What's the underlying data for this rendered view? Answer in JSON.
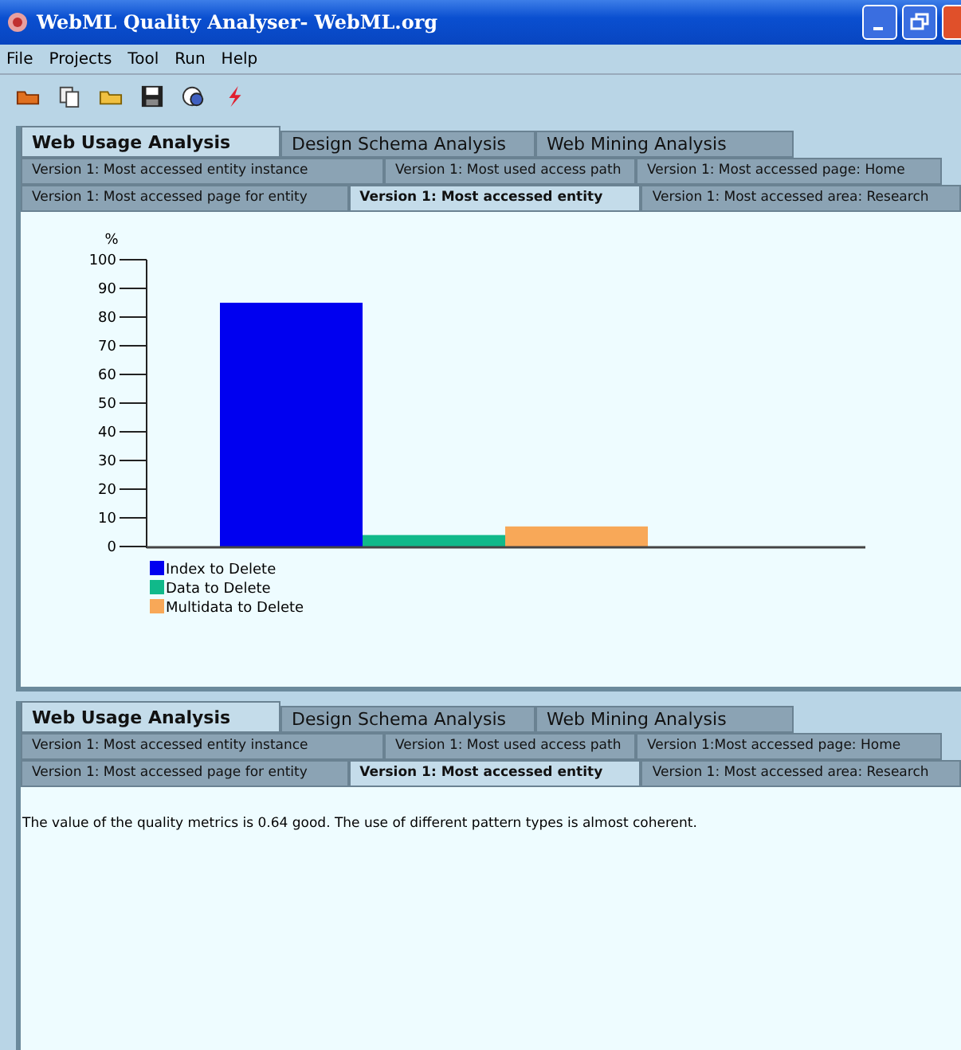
{
  "window": {
    "title": "WebML Quality Analyser- WebML.org"
  },
  "menu": [
    "File",
    "Projects",
    "Tool",
    "Run",
    "Help"
  ],
  "panels": [
    {
      "kind": "chart",
      "tabs": [
        {
          "label": "Web Usage Analysis",
          "selected": true
        },
        {
          "label": "Design Schema Analysis",
          "selected": false
        },
        {
          "label": "Web Mining Analysis",
          "selected": false
        }
      ],
      "sub_tab_rows": [
        [
          {
            "label": "Version 1: Most accessed entity instance",
            "selected": false
          },
          {
            "label": "Version 1: Most used access path",
            "selected": false
          },
          {
            "label": "Version 1: Most accessed page: Home",
            "selected": false
          }
        ],
        [
          {
            "label": "Version 1: Most accessed page for entity",
            "selected": false
          },
          {
            "label": "Version 1: Most accessed entity",
            "selected": true
          },
          {
            "label": "Version 1: Most accessed area: Research",
            "selected": false
          }
        ]
      ],
      "chart_data": {
        "type": "bar",
        "ylabel": "%",
        "legend": "bottom-left",
        "series": [
          {
            "name": "Index to Delete",
            "color": "#0000f0",
            "values": [
              85
            ]
          },
          {
            "name": "Data to Delete",
            "color": "#10b98a",
            "values": [
              4
            ]
          },
          {
            "name": "Multidata to Delete",
            "color": "#f8a858",
            "values": [
              7
            ]
          }
        ],
        "ylim": [
          0,
          100
        ],
        "yticks": [
          0,
          10,
          20,
          30,
          40,
          50,
          60,
          70,
          80,
          90,
          100
        ]
      }
    },
    {
      "kind": "text",
      "tabs": [
        {
          "label": "Web Usage Analysis",
          "selected": true
        },
        {
          "label": "Design Schema Analysis",
          "selected": false
        },
        {
          "label": "Web Mining Analysis",
          "selected": false
        }
      ],
      "sub_tab_rows": [
        [
          {
            "label": "Version 1: Most accessed entity instance",
            "selected": false
          },
          {
            "label": "Version 1: Most used access path",
            "selected": false
          },
          {
            "label": "Version 1:Most accessed page: Home",
            "selected": false
          }
        ],
        [
          {
            "label": "Version 1: Most accessed page for entity",
            "selected": false
          },
          {
            "label": "Version 1: Most accessed entity",
            "selected": true
          },
          {
            "label": "Version 1: Most accessed area: Research",
            "selected": false
          }
        ]
      ],
      "text": "The value of the quality metrics is 0.64 good. The use of different pattern types is almost coherent."
    }
  ]
}
